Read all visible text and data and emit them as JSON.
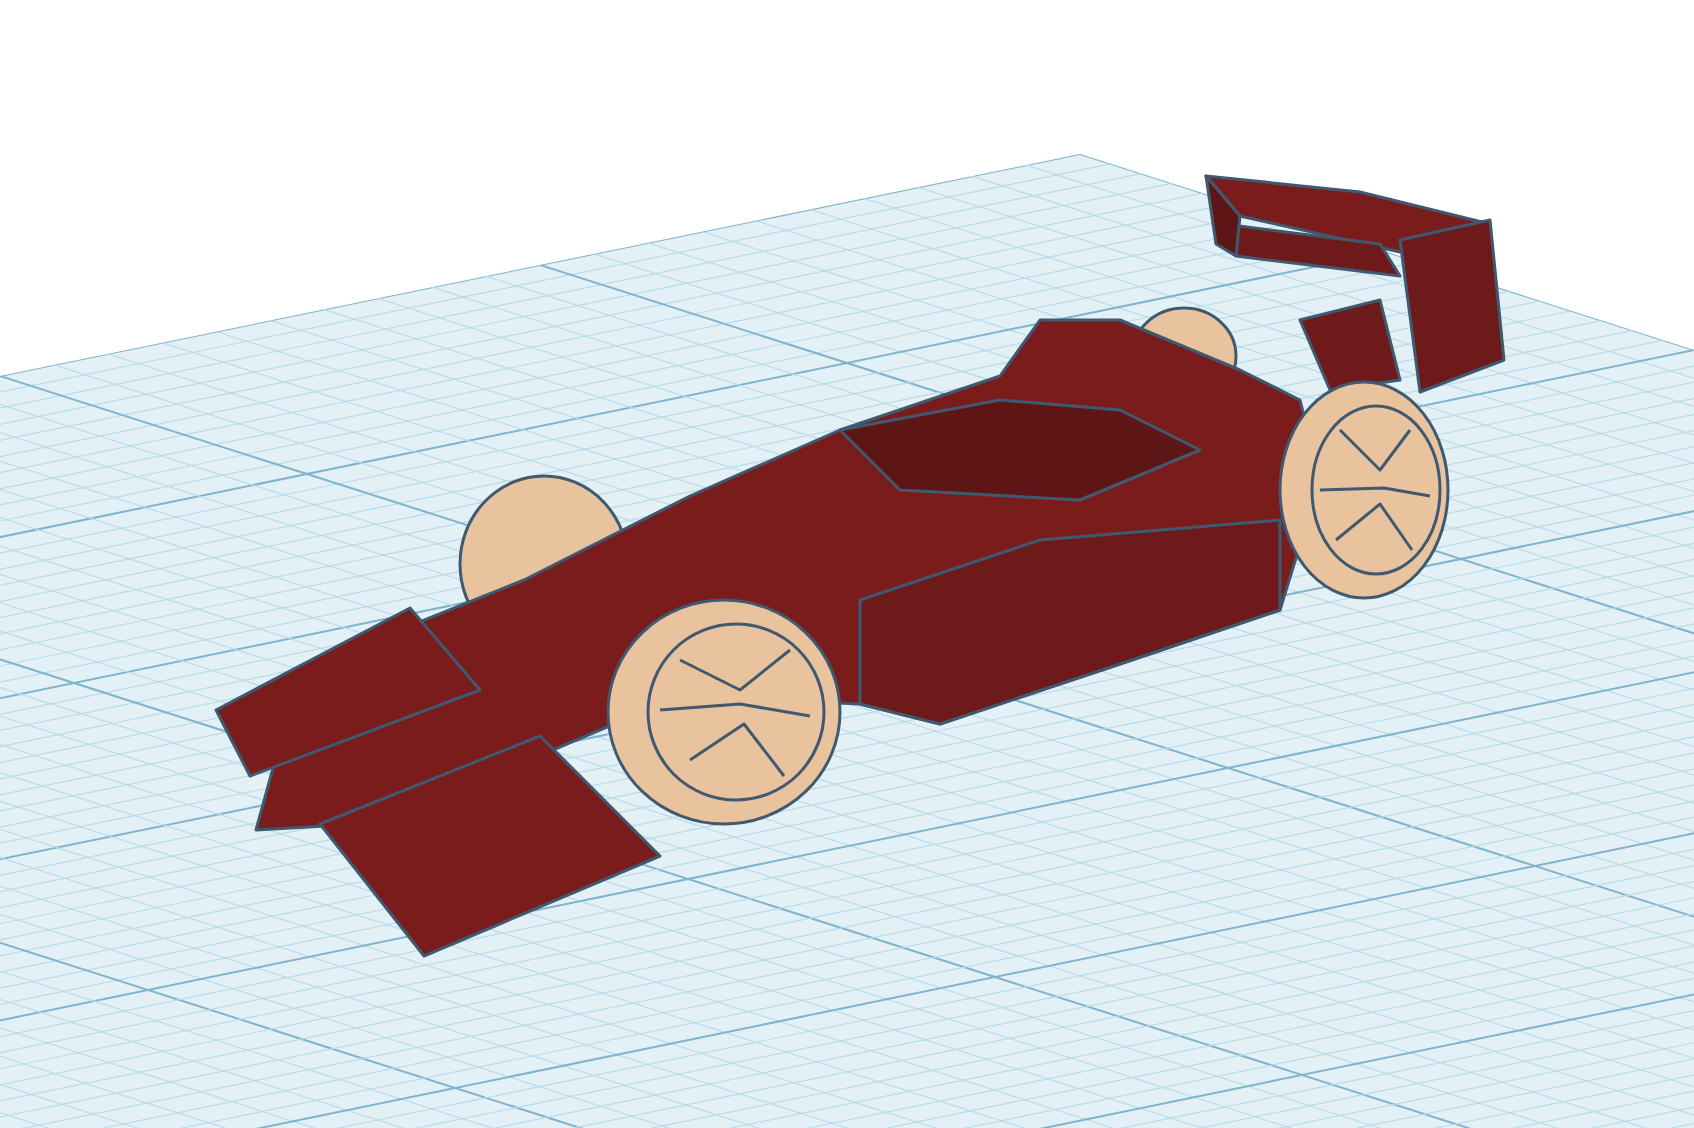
{
  "viewport": {
    "kind": "workplane",
    "model": {
      "kind": "race-car"
    }
  }
}
